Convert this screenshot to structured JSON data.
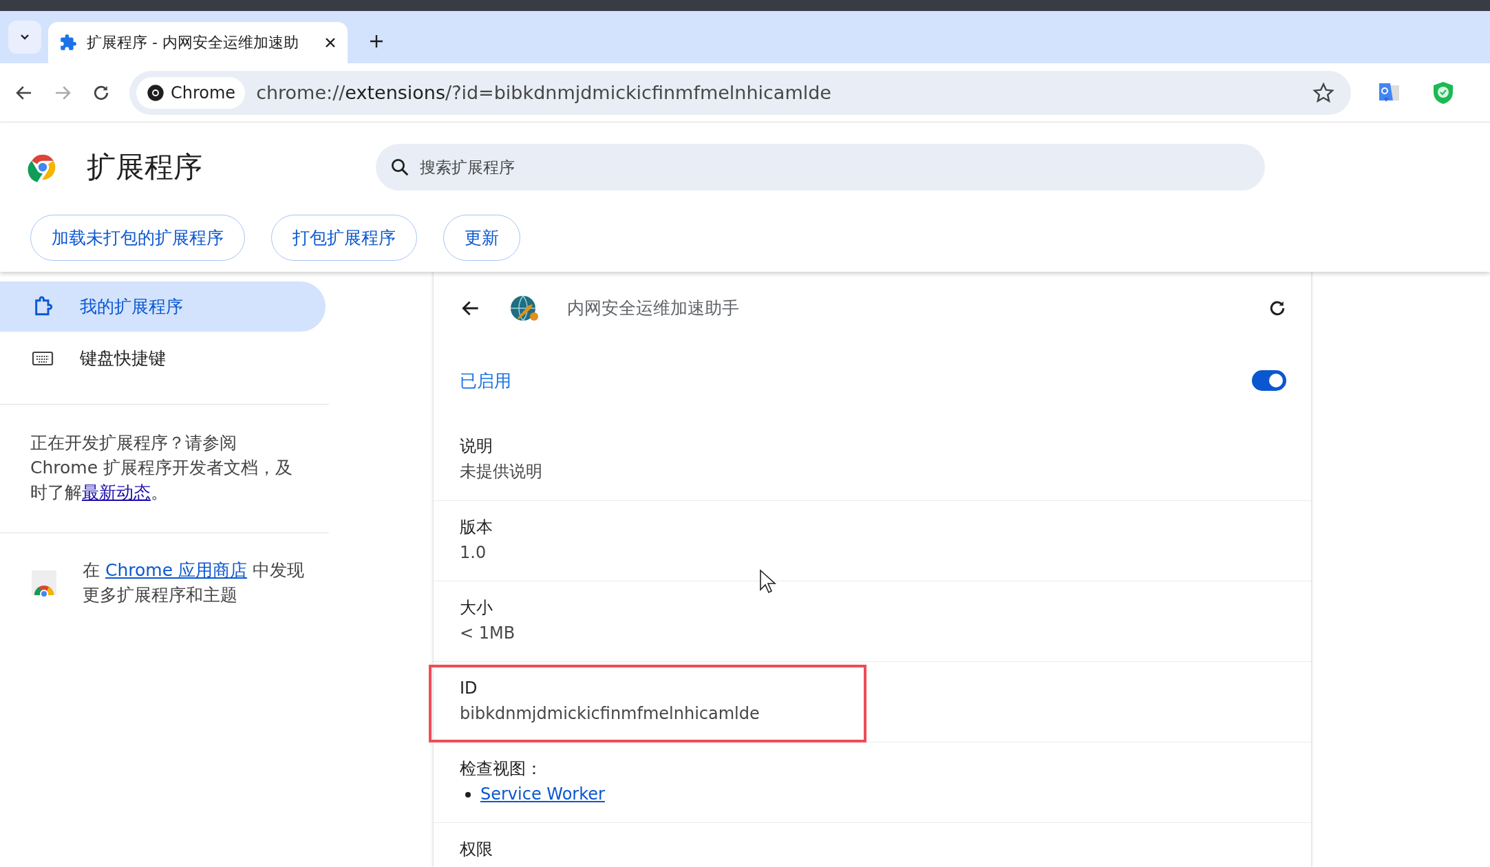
{
  "browser": {
    "tabs": [
      {
        "title": "扩展程序 - 内网安全运维加速助",
        "selected": true
      }
    ],
    "chip": "Chrome",
    "url_base": "chrome://",
    "url_host": "extensions",
    "url_rest": "/?id=bibkdnmjdmickicfinmfmelnhicamlde",
    "bookmarked": false
  },
  "header": {
    "title": "扩展程序",
    "search": {
      "placeholder": "搜索扩展程序"
    },
    "buttons": [
      "加载未打包的扩展程序",
      "打包扩展程序",
      "更新"
    ]
  },
  "sidebar": {
    "items": [
      {
        "label": "我的扩展程序",
        "selected": true
      },
      {
        "label": "键盘快捷键",
        "selected": false
      }
    ],
    "dev_note": {
      "text": "正在开发扩展程序？请参阅 Chrome 扩展程序开发者文档，及时了解",
      "link": "最新动态",
      "end": "。"
    },
    "store_note": {
      "before": "在 ",
      "link": "Chrome 应用商店",
      "after": " 中发现更多扩展程序和主题"
    }
  },
  "detail": {
    "name": "内网安全运维加速助手",
    "enabled_label": "已启用",
    "enabled": true,
    "rows": [
      {
        "kind": "field",
        "label": "说明",
        "value": "未提供说明",
        "highlighted": false
      },
      {
        "kind": "field",
        "label": "版本",
        "value": "1.0",
        "highlighted": false
      },
      {
        "kind": "field",
        "label": "大小",
        "value": "< 1MB",
        "highlighted": false
      },
      {
        "kind": "field",
        "label": "ID",
        "value": "bibkdnmjdmickicfinmfmelnhicamlde",
        "highlighted": true
      },
      {
        "kind": "links",
        "label": "检查视图：",
        "links": [
          "Service Worker"
        ]
      },
      {
        "kind": "heading",
        "label": "权限"
      }
    ]
  }
}
